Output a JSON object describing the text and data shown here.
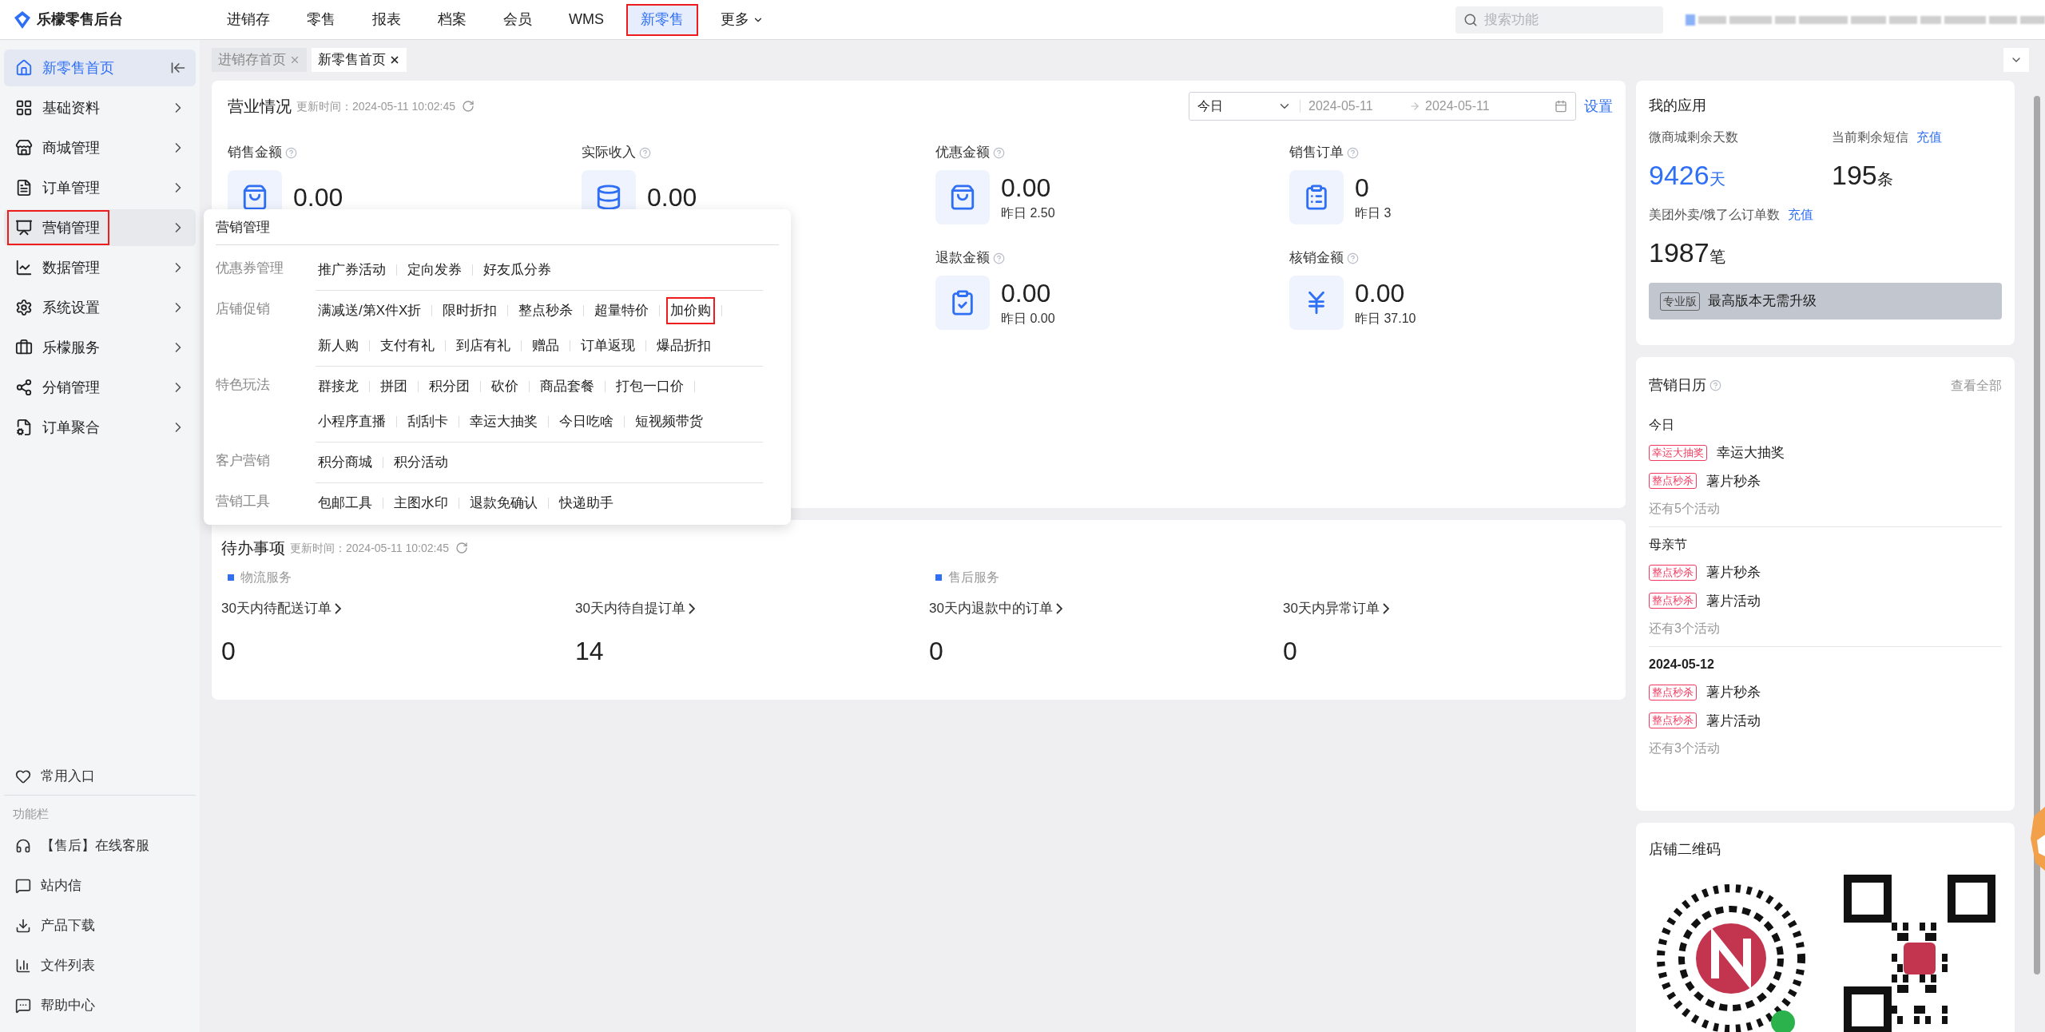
{
  "brand": {
    "name": "乐檬零售后台"
  },
  "top_nav": [
    {
      "label": "进销存",
      "selected": false,
      "highlighted": false
    },
    {
      "label": "零售",
      "selected": false,
      "highlighted": false
    },
    {
      "label": "报表",
      "selected": false,
      "highlighted": false
    },
    {
      "label": "档案",
      "selected": false,
      "highlighted": false
    },
    {
      "label": "会员",
      "selected": false,
      "highlighted": false
    },
    {
      "label": "WMS",
      "selected": false,
      "highlighted": false
    },
    {
      "label": "新零售",
      "selected": true,
      "highlighted": true
    },
    {
      "label": "更多",
      "selected": false,
      "highlighted": false
    }
  ],
  "search": {
    "placeholder": "搜索功能"
  },
  "sidebar": {
    "items": [
      {
        "label": "新零售首页",
        "selected": true,
        "highlighted": false
      },
      {
        "label": "基础资料",
        "selected": false,
        "highlighted": false
      },
      {
        "label": "商城管理",
        "selected": false,
        "highlighted": false
      },
      {
        "label": "订单管理",
        "selected": false,
        "highlighted": false
      },
      {
        "label": "营销管理",
        "selected": false,
        "highlighted": true
      },
      {
        "label": "数据管理",
        "selected": false,
        "highlighted": false
      },
      {
        "label": "系统设置",
        "selected": false,
        "highlighted": false
      },
      {
        "label": "乐檬服务",
        "selected": false,
        "highlighted": false
      },
      {
        "label": "分销管理",
        "selected": false,
        "highlighted": false
      },
      {
        "label": "订单聚合",
        "selected": false,
        "highlighted": false
      }
    ],
    "favorites": "常用入口",
    "section_label": "功能栏",
    "tools": [
      "【售后】在线客服",
      "站内信",
      "产品下载",
      "文件列表",
      "帮助中心"
    ]
  },
  "page_tabs": [
    {
      "label": "进销存首页",
      "selected": false
    },
    {
      "label": "新零售首页",
      "selected": true
    }
  ],
  "business_overview": {
    "title": "营业情况",
    "updated": "更新时间：2024-05-11 10:02:45",
    "period": "今日",
    "date_from": "2024-05-11",
    "date_to": "2024-05-11",
    "settings": "设置",
    "stats": [
      {
        "label": "销售金额",
        "value": "0.00"
      },
      {
        "label": "实际收入",
        "value": "0.00"
      },
      {
        "label": "优惠金额",
        "value": "0.00",
        "yesterday": "昨日 2.50"
      },
      {
        "label": "销售订单",
        "value": "0",
        "yesterday": "昨日 3"
      },
      {
        "label": "退款金额",
        "value": "0.00",
        "yesterday": "昨日 0.00"
      },
      {
        "label": "核销金额",
        "value": "0.00",
        "yesterday": "昨日 37.10"
      }
    ]
  },
  "pending": {
    "title": "待办事项",
    "updated": "更新时间：2024-05-11 10:02:45",
    "groups": [
      "物流服务",
      "售后服务"
    ],
    "tasks": [
      {
        "label": "30天内待配送订单",
        "value": "0"
      },
      {
        "label": "30天内待自提订单",
        "value": "14"
      },
      {
        "label": "30天内退款中的订单",
        "value": "0"
      },
      {
        "label": "30天内异常订单",
        "value": "0"
      }
    ]
  },
  "marketing_menu": {
    "title": "营销管理",
    "sections": [
      {
        "label": "优惠券管理",
        "items": [
          {
            "label": "推广券活动",
            "highlighted": false
          },
          {
            "label": "定向发券",
            "highlighted": false
          },
          {
            "label": "好友瓜分券",
            "highlighted": false
          }
        ]
      },
      {
        "label": "店铺促销",
        "items": [
          {
            "label": "满减送/第X件X折",
            "highlighted": false
          },
          {
            "label": "限时折扣",
            "highlighted": false
          },
          {
            "label": "整点秒杀",
            "highlighted": false
          },
          {
            "label": "超量特价",
            "highlighted": false
          },
          {
            "label": "加价购",
            "highlighted": true
          },
          {
            "label": "新人购",
            "highlighted": false
          },
          {
            "label": "支付有礼",
            "highlighted": false
          },
          {
            "label": "到店有礼",
            "highlighted": false
          },
          {
            "label": "赠品",
            "highlighted": false
          },
          {
            "label": "订单返现",
            "highlighted": false
          },
          {
            "label": "爆品折扣",
            "highlighted": false
          }
        ]
      },
      {
        "label": "特色玩法",
        "items": [
          {
            "label": "群接龙",
            "highlighted": false
          },
          {
            "label": "拼团",
            "highlighted": false
          },
          {
            "label": "积分团",
            "highlighted": false
          },
          {
            "label": "砍价",
            "highlighted": false
          },
          {
            "label": "商品套餐",
            "highlighted": false
          },
          {
            "label": "打包一口价",
            "highlighted": false
          },
          {
            "label": "小程序直播",
            "highlighted": false
          },
          {
            "label": "刮刮卡",
            "highlighted": false
          },
          {
            "label": "幸运大抽奖",
            "highlighted": false
          },
          {
            "label": "今日吃啥",
            "highlighted": false
          },
          {
            "label": "短视频带货",
            "highlighted": false
          }
        ]
      },
      {
        "label": "客户营销",
        "items": [
          {
            "label": "积分商城",
            "highlighted": false
          },
          {
            "label": "积分活动",
            "highlighted": false
          }
        ]
      },
      {
        "label": "营销工具",
        "items": [
          {
            "label": "包邮工具",
            "highlighted": false
          },
          {
            "label": "主图水印",
            "highlighted": false
          },
          {
            "label": "退款免确认",
            "highlighted": false
          },
          {
            "label": "快递助手",
            "highlighted": false
          }
        ]
      }
    ]
  },
  "my_apps": {
    "title": "我的应用",
    "metrics": [
      {
        "label": "微商城剩余天数",
        "value": "9426",
        "unit": "天",
        "accent": true
      },
      {
        "label": "当前剩余短信",
        "link": "充值",
        "value": "195",
        "unit": "条",
        "accent": false
      },
      {
        "label": "美团外卖/饿了么订单数",
        "link": "充值",
        "value": "1987",
        "unit": "笔",
        "accent": false
      }
    ],
    "plan": {
      "badge": "专业版",
      "text": "最高版本无需升级"
    }
  },
  "calendar": {
    "title": "营销日历",
    "view_all": "查看全部",
    "days": [
      {
        "title": "今日",
        "events": [
          {
            "tag": "幸运大抽奖",
            "name": "幸运大抽奖"
          },
          {
            "tag": "整点秒杀",
            "name": "薯片秒杀"
          }
        ],
        "more": "还有5个活动"
      },
      {
        "title": "母亲节",
        "events": [
          {
            "tag": "整点秒杀",
            "name": "薯片秒杀"
          },
          {
            "tag": "整点秒杀",
            "name": "薯片活动"
          }
        ],
        "more": "还有3个活动"
      },
      {
        "title": "2024-05-12",
        "events": [
          {
            "tag": "整点秒杀",
            "name": "薯片秒杀"
          },
          {
            "tag": "整点秒杀",
            "name": "薯片活动"
          }
        ],
        "more": "还有3个活动"
      }
    ]
  },
  "store_qr": {
    "title": "店铺二维码"
  }
}
